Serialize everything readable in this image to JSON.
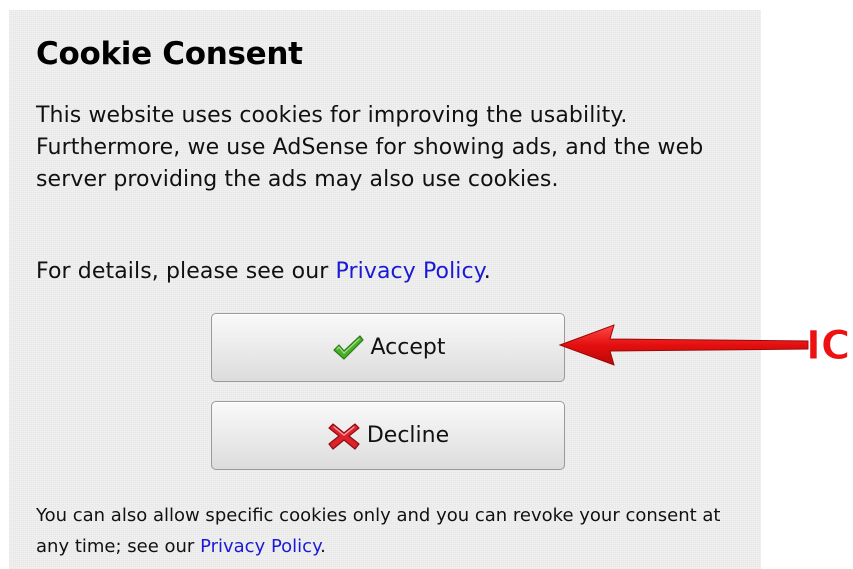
{
  "dialog": {
    "title": "Cookie Consent",
    "intro": "This website uses cookies for improving the usability. Furthermore, we use AdSense for showing ads, and the web server providing the ads may also use cookies.",
    "details_prefix": "For details, please see our ",
    "details_link": "Privacy Policy",
    "details_suffix": ".",
    "accept_label": "Accept",
    "decline_label": "Decline",
    "footer_prefix": "You can also allow specific cookies only and you can revoke your consent at any time; see our ",
    "footer_link": "Privacy Policy",
    "footer_suffix": "."
  },
  "icons": {
    "accept": "checkmark-icon",
    "decline": "red-x-icon"
  },
  "annotation": {
    "label": "ICI",
    "color": "#ee1111"
  },
  "colors": {
    "panel_background": "#f1f1f1",
    "link": "#1a1ad6",
    "check_green": "#4caf2a",
    "decline_red": "#e0202a"
  }
}
